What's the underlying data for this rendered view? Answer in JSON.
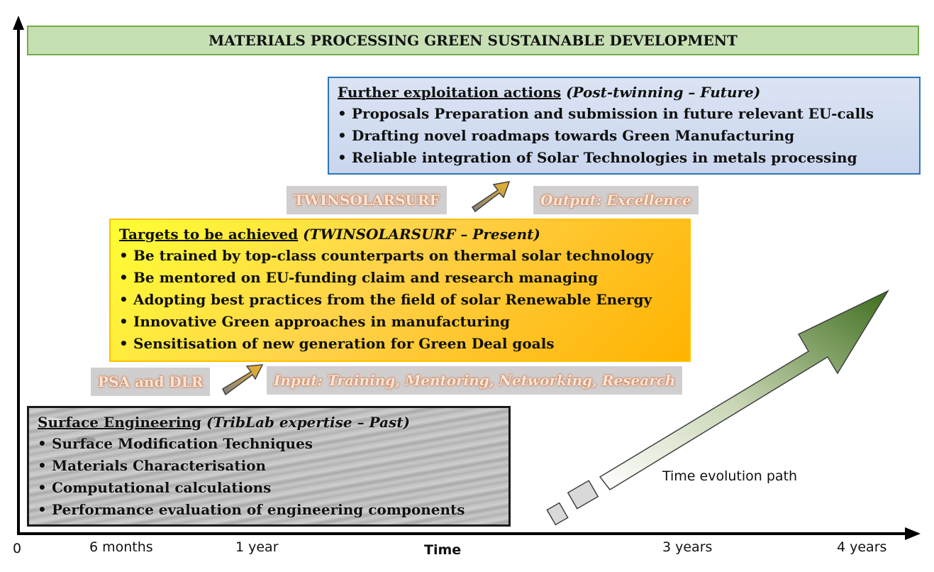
{
  "banner": {
    "title": "MATERIALS PROCESSING GREEN SUSTAINABLE DEVELOPMENT"
  },
  "future": {
    "heading": "Further exploitation actions",
    "heading_note": "(Post-twinning – Future)",
    "items": [
      "Proposals Preparation and submission in future relevant EU-calls",
      "Drafting novel roadmaps towards  Green Manufacturing",
      "Reliable integration of Solar Technologies in metals processing"
    ]
  },
  "present": {
    "heading": "Targets to be achieved",
    "heading_note": "(TWINSOLARSURF – Present)",
    "items": [
      "Be trained by top-class counterparts on thermal solar technology",
      "Be mentored on EU-funding claim and research managing",
      "Adopting best practices from the field of solar Renewable Energy",
      "Innovative Green approaches in manufacturing",
      "Sensitisation of new generation for Green Deal goals"
    ]
  },
  "past": {
    "heading": "Surface Engineering",
    "heading_note": "(TribLab expertise – Past)",
    "items": [
      "Surface Modification Techniques",
      "Materials Characterisation",
      "Computational calculations",
      "Performance evaluation of engineering components"
    ]
  },
  "tags": {
    "twinsolarsurf": "TWINSOLARSURF",
    "output": "Output: Excellence",
    "psa_dlr": "PSA and DLR",
    "input": "Input: Training, Mentoring, Networking, Research"
  },
  "axis": {
    "title": "Time",
    "ticks": [
      "0",
      "6 months",
      "1 year",
      "3 years",
      "4 years"
    ]
  },
  "path_label": "Time evolution path",
  "colors": {
    "banner_fill": "#c6e0b4",
    "future_fill": "#dbe4f3",
    "present_fill": "#ffc000",
    "path_arrow": "#4e7a2a",
    "tag_text_glow": "#c85a1e"
  }
}
